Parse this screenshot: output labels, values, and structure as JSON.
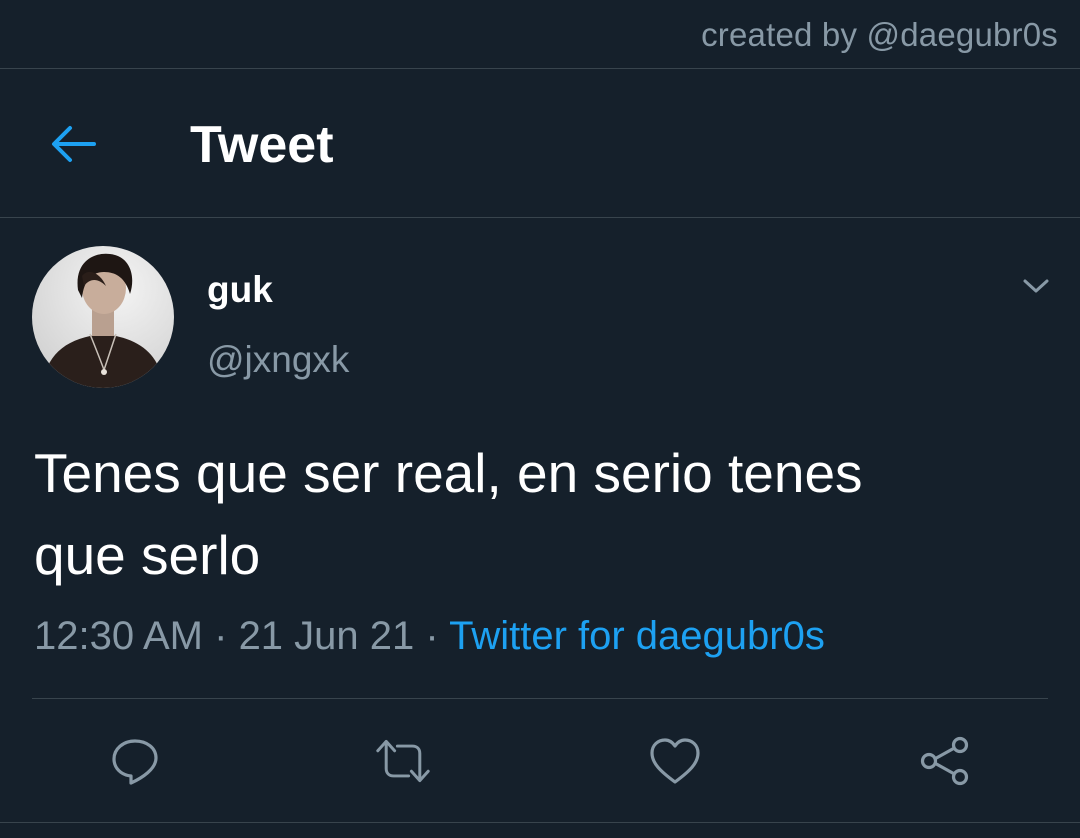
{
  "credit": "created by @daegubr0s",
  "header": {
    "title": "Tweet",
    "back_icon": "arrow-left-icon"
  },
  "author": {
    "name": "guk",
    "handle": "@jxngxk",
    "avatar_icon": "avatar-photo"
  },
  "tweet": {
    "text_line1": "Tenes que ser real, en serio tenes",
    "text_line2": "que serlo",
    "time": "12:30 AM",
    "sep1": " · ",
    "date": "21 Jun 21",
    "sep2": " · ",
    "source": "Twitter for daegubr0s"
  },
  "actions": [
    {
      "icon": "reply-icon"
    },
    {
      "icon": "retweet-icon"
    },
    {
      "icon": "like-icon"
    },
    {
      "icon": "share-icon"
    }
  ],
  "colors": {
    "background": "#15202b",
    "border": "#38444d",
    "secondary_text": "#8899a6",
    "accent": "#1da1f2",
    "primary_text": "#ffffff"
  }
}
